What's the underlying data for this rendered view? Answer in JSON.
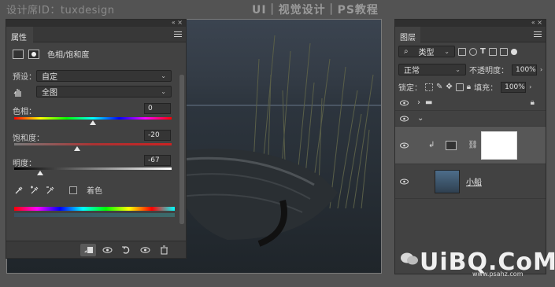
{
  "watermark": {
    "left": "设计席ID：tuxdesign",
    "center": "UI｜视觉设计｜PS教程"
  },
  "properties": {
    "tab_label": "属性",
    "adjustment_title": "色相/饱和度",
    "preset_label": "预设：",
    "preset_value": "自定",
    "channel_value": "全图",
    "hue": {
      "label": "色相：",
      "value": "0",
      "fraction": 0.5
    },
    "saturation": {
      "label": "饱和度：",
      "value": "-20",
      "fraction": 0.4
    },
    "lightness": {
      "label": "明度：",
      "value": "-67",
      "fraction": 0.165
    },
    "colorize_label": "着色"
  },
  "layers": {
    "tab_label": "图层",
    "kind_filter": "类型",
    "blend_mode": "正常",
    "opacity_label": "不透明度：",
    "opacity_value": "100%",
    "lock_label": "锁定：",
    "fill_label": "填充：",
    "fill_value": "100%",
    "items": [
      {
        "name": "",
        "type": "group"
      },
      {
        "name": "",
        "type": "group-open"
      },
      {
        "name": "",
        "type": "adjustment"
      },
      {
        "name": "小船",
        "type": "image"
      }
    ]
  },
  "brand": {
    "logo": "UiBQ.CoM",
    "url": "www.psahz.com"
  }
}
